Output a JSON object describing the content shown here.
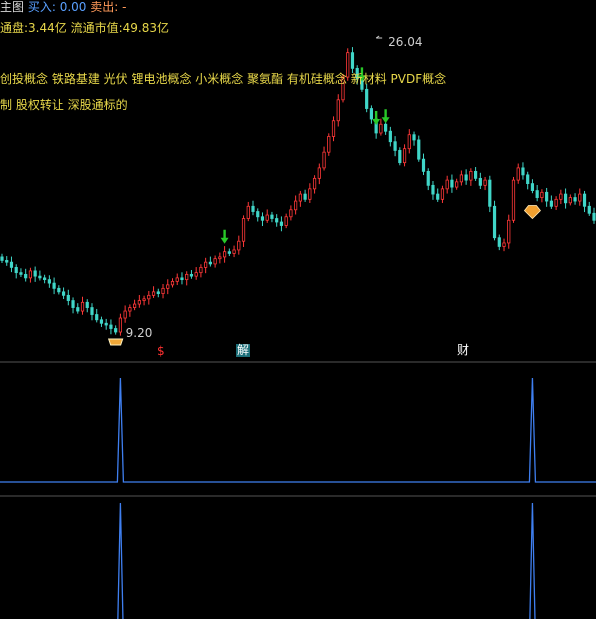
{
  "header": {
    "title": "主图",
    "buy_label": "买入:",
    "buy_value": "0.00",
    "sell_label": "卖出:",
    "sell_value": "-"
  },
  "info": {
    "line1": "通盘:3.44亿  流通市值:49.83亿",
    "line2": "创投概念 铁路基建 光伏 锂电池概念 小米概念 聚氨酯 有机硅概念 新材料 PVDF概念",
    "line3": "制 股权转让 深股通标的"
  },
  "markers": {
    "s_mark": "$",
    "jie_mark": "解",
    "cai_mark": "财"
  },
  "colors": {
    "up": "#ff3838",
    "down": "#40d6c8",
    "arrow": "#28c828",
    "indicator": "#3f7ff0",
    "divider": "#6a6a6a",
    "yellow": "#e8d84a"
  },
  "chart_data": {
    "type": "candlestick",
    "high_label": "26.04",
    "low_label": "9.20",
    "ylim": [
      9.2,
      26.04
    ],
    "closes": [
      13.3,
      13.2,
      12.9,
      12.6,
      12.5,
      12.3,
      12.7,
      12.4,
      12.3,
      12.2,
      12.0,
      11.7,
      11.5,
      11.3,
      11.0,
      10.6,
      10.4,
      10.9,
      10.6,
      10.2,
      9.9,
      9.7,
      9.6,
      9.4,
      9.2,
      10.0,
      10.4,
      10.6,
      10.8,
      11.0,
      11.1,
      11.3,
      11.5,
      11.4,
      11.7,
      11.9,
      12.1,
      12.3,
      12.2,
      12.5,
      12.4,
      12.6,
      12.9,
      13.2,
      13.1,
      13.4,
      13.5,
      13.8,
      13.7,
      13.9,
      14.4,
      15.7,
      16.4,
      16.1,
      15.8,
      15.6,
      15.9,
      15.7,
      15.5,
      15.3,
      15.8,
      16.2,
      16.7,
      17.1,
      16.8,
      17.4,
      18.0,
      18.6,
      19.5,
      20.4,
      21.3,
      22.5,
      23.8,
      25.2,
      24.3,
      23.7,
      23.1,
      22.0,
      21.4,
      20.6,
      21.1,
      20.7,
      20.1,
      19.6,
      18.9,
      19.7,
      20.5,
      20.2,
      19.1,
      18.4,
      17.6,
      17.1,
      16.8,
      17.4,
      17.9,
      17.5,
      17.8,
      18.2,
      17.9,
      18.4,
      18.0,
      17.6,
      17.9,
      16.4,
      14.6,
      14.1,
      14.3,
      15.6,
      17.9,
      18.6,
      18.2,
      17.7,
      17.3,
      16.9,
      17.2,
      16.7,
      16.4,
      16.8,
      17.1,
      16.6,
      16.9,
      16.7,
      17.1,
      16.4,
      16.0,
      15.6
    ],
    "buy_arrows_at": [
      47,
      76,
      79,
      81
    ],
    "low_index": 24,
    "high_index": 79,
    "diamond_index": 112,
    "indicator_spikes_at": [
      25,
      112
    ]
  }
}
